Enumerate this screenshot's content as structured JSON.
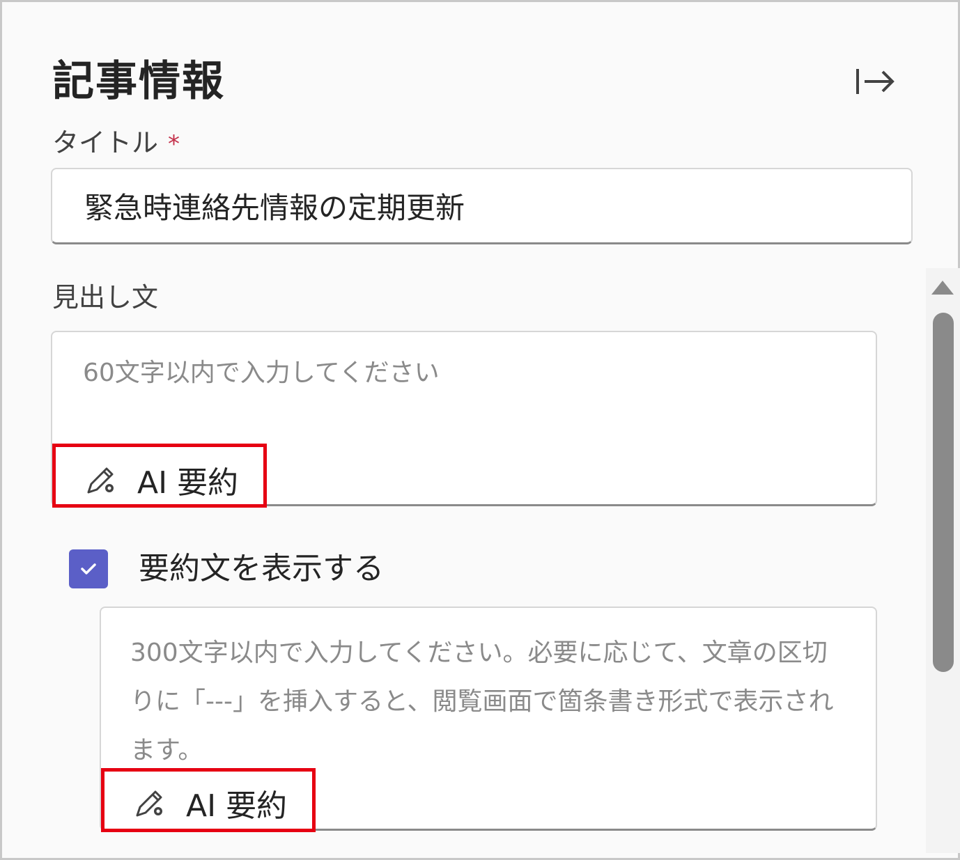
{
  "panel": {
    "heading": "記事情報",
    "collapse_icon": "arrow-right-to-panel-icon"
  },
  "title_field": {
    "label": "タイトル",
    "required_mark": "*",
    "value": "緊急時連絡先情報の定期更新"
  },
  "lead_field": {
    "label": "見出し文",
    "placeholder": "60文字以内で入力してください",
    "ai_button_label": "AI 要約"
  },
  "summary_toggle": {
    "label": "要約文を表示する",
    "checked": true
  },
  "summary_field": {
    "placeholder": "300文字以内で入力してください。必要に応じて、文章の区切りに「---」を挿入すると、閲覧画面で箇条書き形式で表示されます。",
    "ai_button_label": "AI 要約"
  },
  "colors": {
    "accent": "#5b5fc7",
    "highlight": "#e60012",
    "required": "#c4314b"
  }
}
